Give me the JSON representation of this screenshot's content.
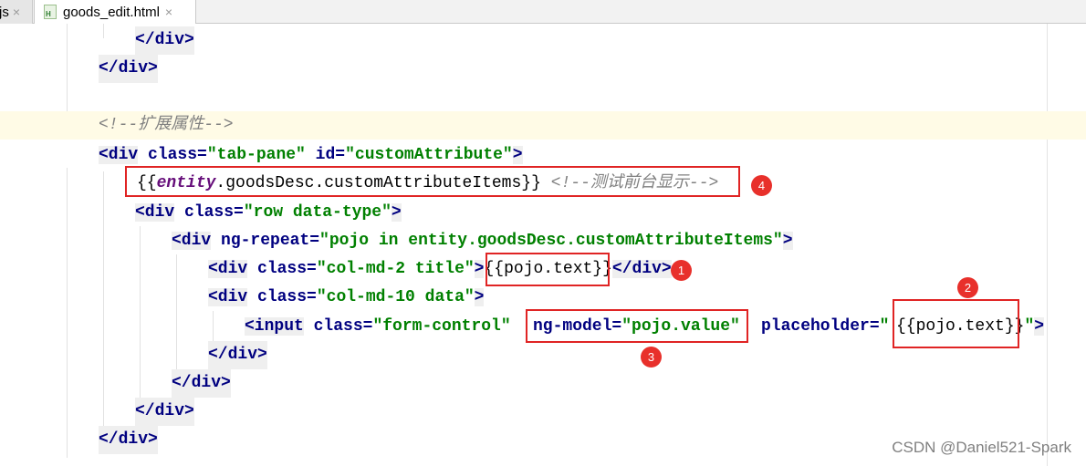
{
  "tabs": [
    {
      "label": "js",
      "close": "×"
    },
    {
      "label": "goods_edit.html",
      "close": "×",
      "icon": "html-file-icon"
    }
  ],
  "code": {
    "l1": "</div>",
    "l2": "</div>",
    "l4": "<!--扩展属性-->",
    "l5": {
      "open": "<div",
      "attr1": " class=",
      "v1": "\"tab-pane\"",
      "attr2": " id=",
      "v2": "\"customAttribute\"",
      "close": ">"
    },
    "l6": {
      "pre": "{{",
      "ent": "entity",
      "rest": ".goodsDesc.customAttributeItems",
      "post": "}}",
      "comment": " <!--测试前台显示-->"
    },
    "l7": {
      "open": "<div",
      "attr1": " class=",
      "v1": "\"row data-type\"",
      "close": ">"
    },
    "l8": {
      "open": "<div",
      "attr1": " ng-repeat=",
      "v1": "\"pojo in entity.goodsDesc.customAttributeItems\"",
      "close": ">"
    },
    "l9": {
      "open": "<div",
      "attr1": " class=",
      "v1": "\"col-md-2 title\"",
      "close": ">",
      "expr": "{{pojo.text}}",
      "end": "</div>"
    },
    "l10": {
      "open": "<div",
      "attr1": " class=",
      "v1": "\"col-md-10 data\"",
      "close": ">"
    },
    "l11": {
      "open": "<input",
      "attr1": " class=",
      "v1": "\"form-control\"",
      "attr2": "ng-model=",
      "v2": "\"pojo.value\"",
      "attr3": "placeholder=",
      "q1": "\"",
      "expr": "{{pojo.text}}",
      "q2": "\"",
      "close": ">"
    },
    "l12": "</div>",
    "l13": "</div>",
    "l14": "</div>",
    "l15": "</div>"
  },
  "badges": [
    "1",
    "2",
    "3",
    "4"
  ],
  "watermark": "CSDN @Daniel521-Spark",
  "colors": {
    "annotation": "#e02424",
    "tag": "#000080",
    "string": "#008000",
    "comment": "#808080"
  }
}
